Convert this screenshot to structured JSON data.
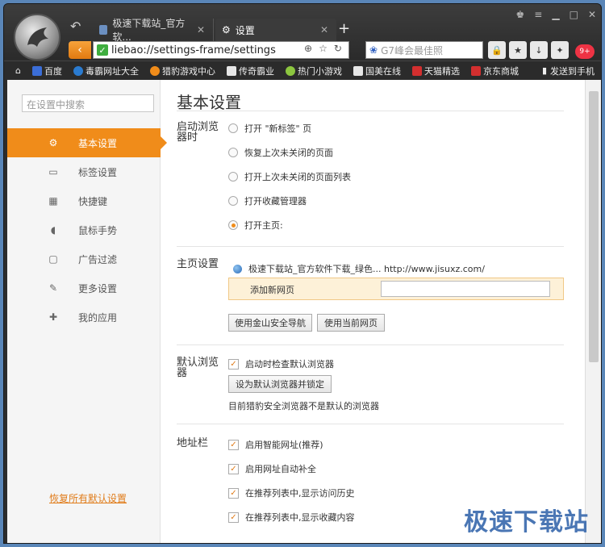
{
  "tabs": [
    {
      "title": "极速下载站_官方软..."
    },
    {
      "title": "设置"
    }
  ],
  "address": {
    "url": "liebao://settings-frame/settings"
  },
  "search": {
    "placeholder": "G7峰会最佳照"
  },
  "bookmarks": [
    {
      "label": "百度",
      "color": "#3b6ed8"
    },
    {
      "label": "毒霸网址大全",
      "color": "#2a7bd0"
    },
    {
      "label": "猎豹游戏中心",
      "color": "#f08c1a"
    },
    {
      "label": "传奇霸业",
      "color": "#e6e6e6"
    },
    {
      "label": "热门小游戏",
      "color": "#8cc63f"
    },
    {
      "label": "国美在线",
      "color": "#e6e6e6"
    },
    {
      "label": "天猫精选",
      "color": "#d32f2f"
    },
    {
      "label": "京东商城",
      "color": "#d32f2f"
    }
  ],
  "send_phone": "发送到手机",
  "sidebar": {
    "search_placeholder": "在设置中搜索",
    "items": [
      {
        "label": "基本设置",
        "icon": "gear-icon",
        "active": true
      },
      {
        "label": "标签设置",
        "icon": "tab-icon"
      },
      {
        "label": "快捷键",
        "icon": "keyboard-icon"
      },
      {
        "label": "鼠标手势",
        "icon": "mouse-icon"
      },
      {
        "label": "广告过滤",
        "icon": "filter-icon"
      },
      {
        "label": "更多设置",
        "icon": "wrench-icon"
      },
      {
        "label": "我的应用",
        "icon": "puzzle-icon"
      }
    ],
    "restore": "恢复所有默认设置"
  },
  "main": {
    "title": "基本设置",
    "startup": {
      "label": "启动浏览器时",
      "options": [
        "打开 \"新标签\" 页",
        "恢复上次未关闭的页面",
        "打开上次未关闭的页面列表",
        "打开收藏管理器",
        "打开主页:"
      ],
      "selected": 4
    },
    "homepage": {
      "label": "主页设置",
      "site": "极速下载站_官方软件下载_绿色...  http://www.jisuxz.com/",
      "add_label": "添加新网页",
      "btn1": "使用金山安全导航",
      "btn2": "使用当前网页"
    },
    "default_browser": {
      "label": "默认浏览器",
      "check": "启动时检查默认浏览器",
      "btn": "设为默认浏览器并锁定",
      "note": "目前猎豹安全浏览器不是默认的浏览器"
    },
    "addressbar": {
      "label": "地址栏",
      "checks": [
        "启用智能网址(推荐)",
        "启用网址自动补全",
        "在推荐列表中,显示访问历史",
        "在推荐列表中,显示收藏内容"
      ]
    }
  },
  "watermark": "极速下载站"
}
